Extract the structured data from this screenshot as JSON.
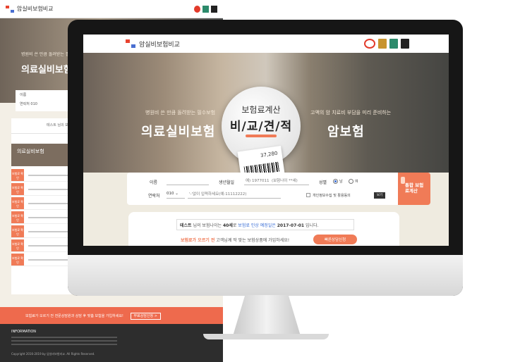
{
  "brand": {
    "name": "암실비보험비교",
    "accent": "#f07b57",
    "blue": "#3b6fd6"
  },
  "back_page": {
    "logo": "암실비보험비교",
    "hero_sub": "병원비 쓴 만큼 돌려받는 필수보험",
    "hero_title": "의료실비보험",
    "form_labels": [
      "이름",
      "연락처"
    ],
    "phone_prefix": "010",
    "section_title": "의료실비보험",
    "tab_text": "테스트 님의 보험나이는",
    "row_tag": "보험료 확인",
    "cta": "보험료가 오르기 전 전문상담원과 상담 후 맞춤 보험을 가입하세요!",
    "cta_button": "무료상담신청 >",
    "footer_title": "INFORMATION",
    "footer_copyright": "Copyright 2016-2019 by 암실비보험비교. All Rights Reserved."
  },
  "screen": {
    "logo": "암실비보험비교",
    "hero_left_sub": "병원비 쓴 만큼 돌려받는 필수보험",
    "hero_left_title": "의료실비보험",
    "hero_right_sub": "고액의 암 치료비 부담을 미리 준비하는",
    "hero_right_title": "암보험",
    "badge_line1": "보험료계산",
    "badge_line2": "비/교/견/적",
    "receipt_amount": "37,280",
    "form": {
      "name_label": "이름",
      "birth_label": "생년월일",
      "birth_placeholder": "예) 1977011  (보험나이 **세)",
      "gender_label": "성별",
      "male": "남",
      "female": "여",
      "phone_label": "연락처",
      "phone_prefix": "010",
      "phone_placeholder": "'-'없이 입력하세요(예:11112222)",
      "consent": "개인정보수집 및 활용동의",
      "view": "보기",
      "submit": "통합 보험료계산"
    },
    "result": {
      "name": "테스트",
      "text1": "님의 보험나이는",
      "age": "40세",
      "text2": "로",
      "date_label": "보험료 인상 예정일은",
      "date": "2017-07-01",
      "text3": "입니다.",
      "line_hl": "보험료가 오르기 전",
      "line_rest": "고객님께 딱 맞는 보험상품에 가입하세요!",
      "button": "빠른상담신청"
    }
  }
}
